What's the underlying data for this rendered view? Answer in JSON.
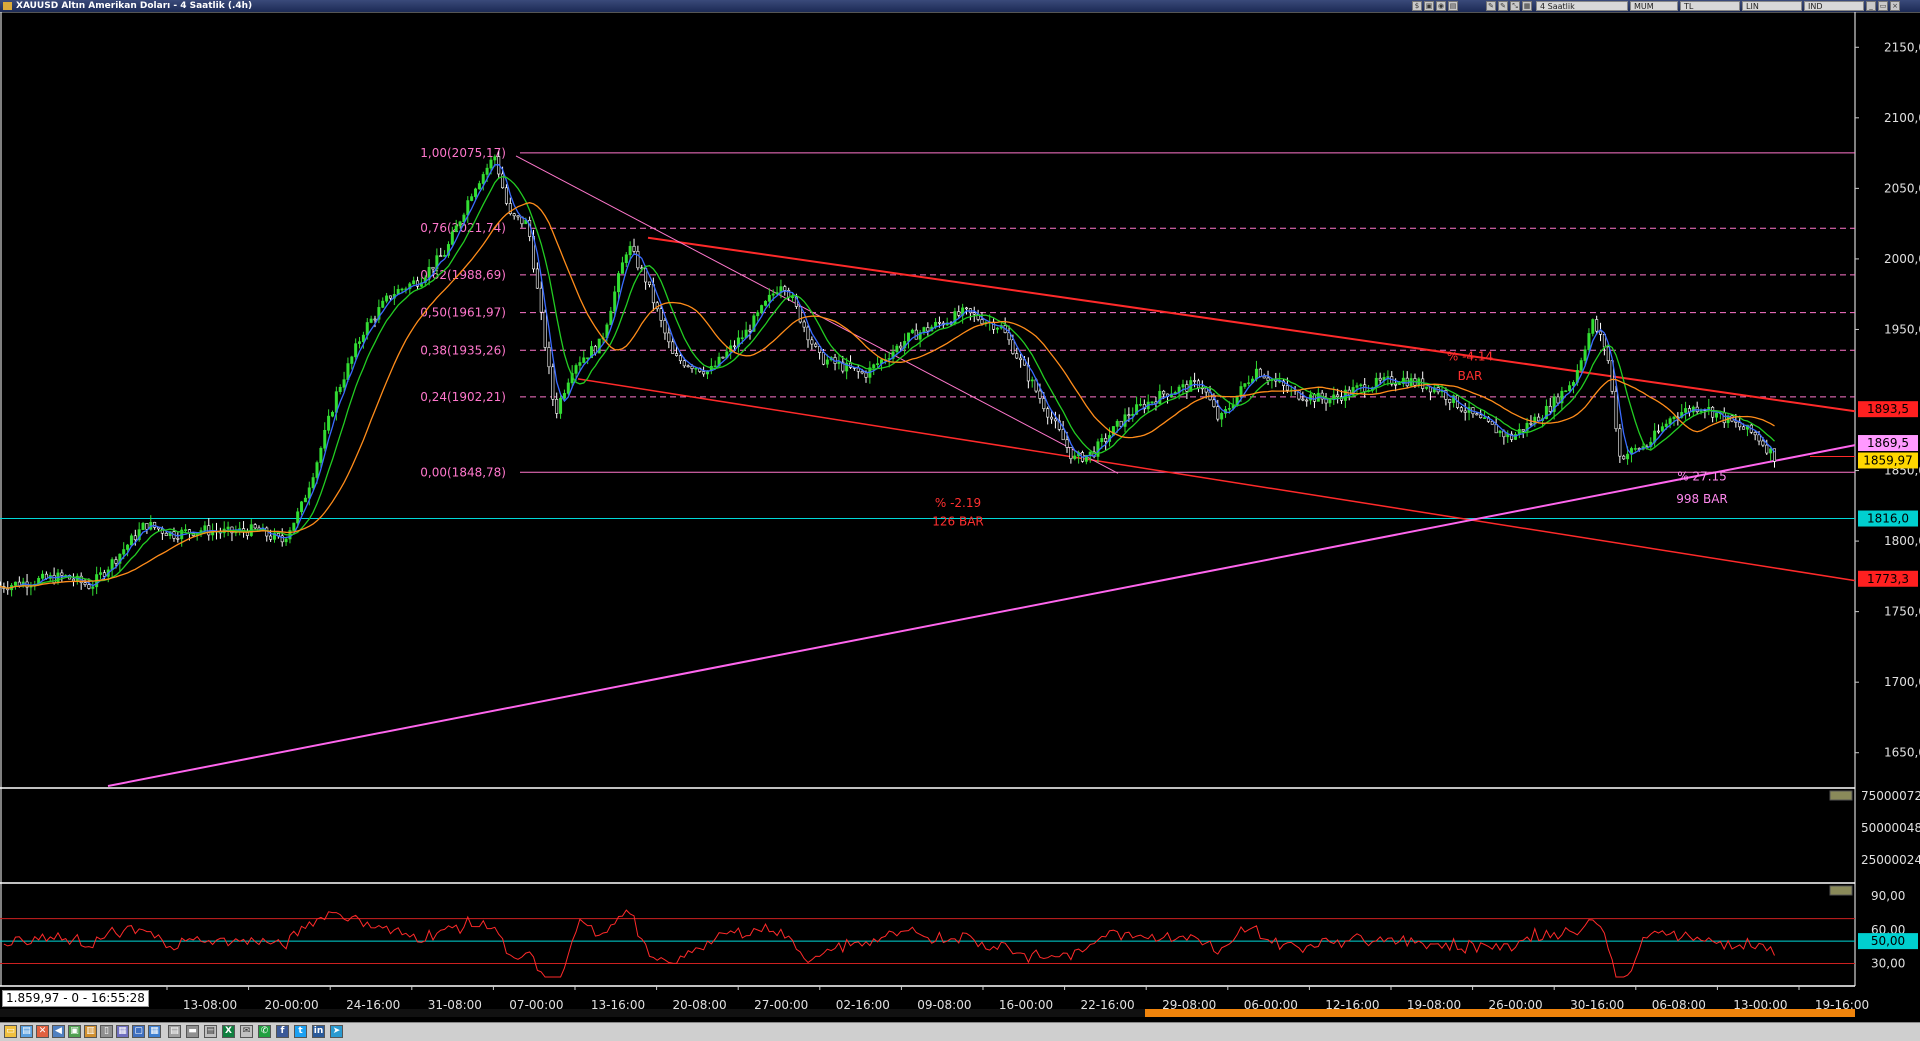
{
  "window": {
    "title": "XAUUSD Altın Amerikan Doları - 4 Saatlik (.4h)"
  },
  "toolbar": {
    "items": [
      "4 Saatlik",
      "MUM",
      "TL",
      "LIN",
      "IND"
    ]
  },
  "readout": "1.859,97 - 0 - 16:55:28",
  "colors": {
    "background": "#000000",
    "candle_up": "#33dd33",
    "fib_line": "#ff77cc",
    "trend_red": "#ff2a2a",
    "trend_magenta": "#ff66ee",
    "support_cyan": "#00d8d8",
    "ma_blue": "#3a6bff",
    "ma_green": "#22cc22",
    "ma_orange": "#ff8c1a",
    "axis_text": "#e0e0e0"
  },
  "chart_data": [
    {
      "type": "candlestick",
      "title": "XAUUSD Altın Amerikan Doları - 4 Saatlik (.4h)",
      "x_tick_labels": [
        "13-08:00",
        "20-00:00",
        "24-16:00",
        "31-08:00",
        "07-00:00",
        "13-16:00",
        "20-08:00",
        "27-00:00",
        "02-16:00",
        "09-08:00",
        "16-00:00",
        "22-16:00",
        "29-08:00",
        "06-00:00",
        "12-16:00",
        "19-08:00",
        "26-00:00",
        "30-16:00",
        "06-08:00",
        "13-00:00",
        "19-16:00"
      ],
      "y_tick_labels": [
        "2150,00",
        "2100,00",
        "2050,00",
        "2000,00",
        "1950,00",
        "1850,00",
        "1800,00",
        "1750,00",
        "1700,00",
        "1650,00"
      ],
      "ylim": [
        1625,
        2175
      ],
      "price_path": [
        {
          "x": 0.0,
          "y": 1768
        },
        {
          "x": 0.02,
          "y": 1772
        },
        {
          "x": 0.035,
          "y": 1775
        },
        {
          "x": 0.05,
          "y": 1768
        },
        {
          "x": 0.065,
          "y": 1790
        },
        {
          "x": 0.08,
          "y": 1812
        },
        {
          "x": 0.095,
          "y": 1805
        },
        {
          "x": 0.11,
          "y": 1808
        },
        {
          "x": 0.125,
          "y": 1806
        },
        {
          "x": 0.14,
          "y": 1808
        },
        {
          "x": 0.155,
          "y": 1800
        },
        {
          "x": 0.165,
          "y": 1822
        },
        {
          "x": 0.175,
          "y": 1860
        },
        {
          "x": 0.185,
          "y": 1905
        },
        {
          "x": 0.2,
          "y": 1950
        },
        {
          "x": 0.215,
          "y": 1975
        },
        {
          "x": 0.23,
          "y": 1985
        },
        {
          "x": 0.245,
          "y": 2005
        },
        {
          "x": 0.26,
          "y": 2050
        },
        {
          "x": 0.272,
          "y": 2073
        },
        {
          "x": 0.28,
          "y": 2030
        },
        {
          "x": 0.29,
          "y": 2025
        },
        {
          "x": 0.3,
          "y": 1935
        },
        {
          "x": 0.305,
          "y": 1890
        },
        {
          "x": 0.315,
          "y": 1925
        },
        {
          "x": 0.33,
          "y": 1940
        },
        {
          "x": 0.345,
          "y": 2010
        },
        {
          "x": 0.355,
          "y": 1985
        },
        {
          "x": 0.37,
          "y": 1930
        },
        {
          "x": 0.39,
          "y": 1920
        },
        {
          "x": 0.41,
          "y": 1948
        },
        {
          "x": 0.43,
          "y": 1985
        },
        {
          "x": 0.45,
          "y": 1930
        },
        {
          "x": 0.475,
          "y": 1918
        },
        {
          "x": 0.5,
          "y": 1945
        },
        {
          "x": 0.53,
          "y": 1962
        },
        {
          "x": 0.55,
          "y": 1952
        },
        {
          "x": 0.57,
          "y": 1905
        },
        {
          "x": 0.59,
          "y": 1858
        },
        {
          "x": 0.6,
          "y": 1862
        },
        {
          "x": 0.62,
          "y": 1890
        },
        {
          "x": 0.64,
          "y": 1905
        },
        {
          "x": 0.66,
          "y": 1912
        },
        {
          "x": 0.67,
          "y": 1885
        },
        {
          "x": 0.69,
          "y": 1922
        },
        {
          "x": 0.71,
          "y": 1905
        },
        {
          "x": 0.73,
          "y": 1900
        },
        {
          "x": 0.75,
          "y": 1910
        },
        {
          "x": 0.77,
          "y": 1915
        },
        {
          "x": 0.79,
          "y": 1908
        },
        {
          "x": 0.81,
          "y": 1888
        },
        {
          "x": 0.83,
          "y": 1873
        },
        {
          "x": 0.85,
          "y": 1893
        },
        {
          "x": 0.865,
          "y": 1915
        },
        {
          "x": 0.875,
          "y": 1955
        },
        {
          "x": 0.883,
          "y": 1935
        },
        {
          "x": 0.89,
          "y": 1860
        },
        {
          "x": 0.905,
          "y": 1868
        },
        {
          "x": 0.92,
          "y": 1890
        },
        {
          "x": 0.935,
          "y": 1896
        },
        {
          "x": 0.95,
          "y": 1885
        },
        {
          "x": 0.965,
          "y": 1875
        },
        {
          "x": 0.975,
          "y": 1859.97
        }
      ],
      "fibonacci_levels": [
        {
          "label": "1,00(2075,17)",
          "value": 2075.17
        },
        {
          "label": "0,76(2021,74)",
          "value": 2021.74
        },
        {
          "label": "0,62(1988,69)",
          "value": 1988.69
        },
        {
          "label": "0,50(1961,97)",
          "value": 1961.97
        },
        {
          "label": "0,38(1935,26)",
          "value": 1935.26
        },
        {
          "label": "0,24(1902,21)",
          "value": 1902.21
        },
        {
          "label": "0,00(1848,78)",
          "value": 1848.78
        }
      ],
      "price_tags": [
        {
          "value": "1893,5",
          "color": "#ff2020",
          "text_color": "#000000"
        },
        {
          "value": "1869,5",
          "color": "#ff99ff",
          "text_color": "#000000"
        },
        {
          "value": "1859,97",
          "color": "#ffd700",
          "text_color": "#000000"
        },
        {
          "value": "1816,0",
          "color": "#00d0d0",
          "text_color": "#000000"
        },
        {
          "value": "1773,3",
          "color": "#ff2020",
          "text_color": "#000000"
        }
      ],
      "support_level": 1816.0,
      "annotations": [
        {
          "text": "% -2.19",
          "color": "#ff3030"
        },
        {
          "text": "126 BAR",
          "color": "#ff3030"
        },
        {
          "text": "% 27.15",
          "color": "#ff88ee"
        },
        {
          "text": "998 BAR",
          "color": "#ff88ee"
        },
        {
          "text": "% -4.14",
          "color": "#ff3030"
        },
        {
          "text": "BAR",
          "color": "#ff3030"
        }
      ]
    },
    {
      "type": "bar",
      "title": "",
      "y_tick_labels": [
        "75000072",
        "50000048",
        "25000024"
      ],
      "values": []
    },
    {
      "type": "line",
      "title": "",
      "y_tick_labels": [
        "90,00",
        "60,00",
        "30,00"
      ],
      "current_value_tag": "50,00",
      "levels": [
        70,
        50,
        30
      ],
      "ylim": [
        10,
        100
      ]
    }
  ]
}
